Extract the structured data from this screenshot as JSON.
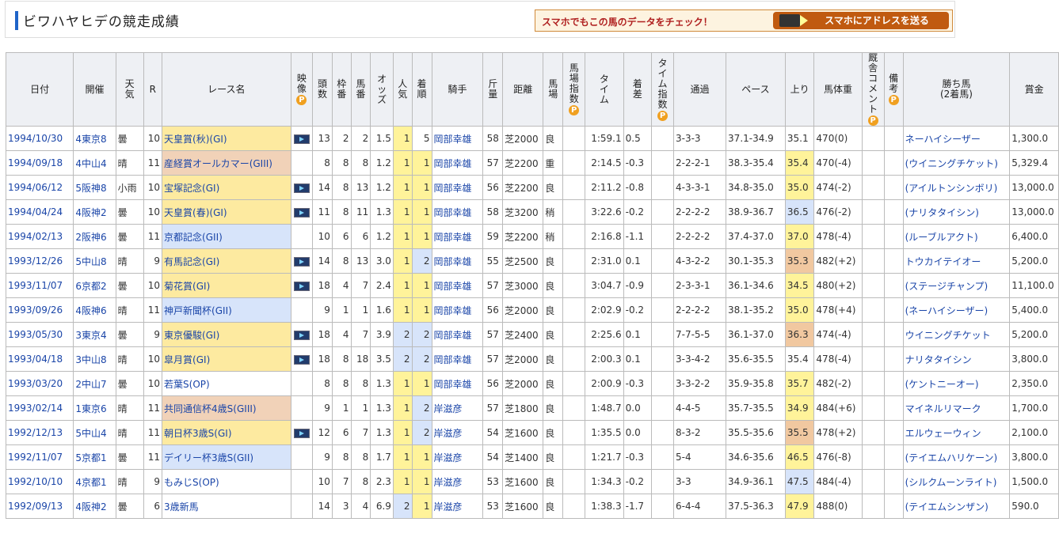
{
  "header": {
    "title": "ビワハヤヒデの競走成績",
    "smapho_text": "スマホでもこの馬のデータをチェック！",
    "smapho_button": "スマホにアドレスを送る"
  },
  "columns": [
    "日付",
    "開催",
    "天気",
    "R",
    "レース名",
    "映像",
    "頭数",
    "枠番",
    "馬番",
    "オッズ",
    "人気",
    "着順",
    "騎手",
    "斤量",
    "距離",
    "馬場",
    "馬場指数",
    "タイム",
    "着差",
    "タイム指数",
    "通過",
    "ペース",
    "上り",
    "馬体重",
    "厩舎コメント",
    "備考",
    "勝ち馬(2着馬)",
    "賞金"
  ],
  "colors": {
    "accent": "#1f64c8",
    "g1": "#fdeaa0",
    "g2": "#d7e4fa",
    "g3": "#f1d2b8",
    "link": "#1a45a8"
  },
  "rows": [
    {
      "date": "1994/10/30",
      "venue": "4東京8",
      "weather": "曇",
      "r": "10",
      "race": "天皇賞(秋)(GI)",
      "grade": "g1",
      "video": true,
      "n": "13",
      "waku": "2",
      "uma": "2",
      "odds": "1.5",
      "pop": "1",
      "rank": "5",
      "jockey": "岡部幸雄",
      "kin": "58",
      "dist": "芝2000",
      "baba": "良",
      "time": "1:59.1",
      "diff": "0.5",
      "pass": "3-3-3",
      "pace": "37.1-34.9",
      "up": "35.1",
      "upc": "",
      "weight": "470(0)",
      "winner": "ネーハイシーザー",
      "prize": "1,300.0"
    },
    {
      "date": "1994/09/18",
      "venue": "4中山4",
      "weather": "晴",
      "r": "11",
      "race": "産経賞オールカマー(GIII)",
      "grade": "g3",
      "video": false,
      "n": "8",
      "waku": "8",
      "uma": "8",
      "odds": "1.2",
      "pop": "1",
      "rank": "1",
      "jockey": "岡部幸雄",
      "kin": "57",
      "dist": "芝2200",
      "baba": "重",
      "time": "2:14.5",
      "diff": "-0.3",
      "pass": "2-2-2-1",
      "pace": "38.3-35.4",
      "up": "35.4",
      "upc": "up1",
      "weight": "470(-4)",
      "winner": "(ウイニングチケット)",
      "prize": "5,329.4"
    },
    {
      "date": "1994/06/12",
      "venue": "5阪神8",
      "weather": "小雨",
      "r": "10",
      "race": "宝塚記念(GI)",
      "grade": "g1",
      "video": true,
      "n": "14",
      "waku": "8",
      "uma": "13",
      "odds": "1.2",
      "pop": "1",
      "rank": "1",
      "jockey": "岡部幸雄",
      "kin": "56",
      "dist": "芝2200",
      "baba": "良",
      "time": "2:11.2",
      "diff": "-0.8",
      "pass": "4-3-3-1",
      "pace": "34.8-35.0",
      "up": "35.0",
      "upc": "up1",
      "weight": "474(-2)",
      "winner": "(アイルトンシンボリ)",
      "prize": "13,000.0"
    },
    {
      "date": "1994/04/24",
      "venue": "4阪神2",
      "weather": "曇",
      "r": "10",
      "race": "天皇賞(春)(GI)",
      "grade": "g1",
      "video": true,
      "n": "11",
      "waku": "8",
      "uma": "11",
      "odds": "1.3",
      "pop": "1",
      "rank": "1",
      "jockey": "岡部幸雄",
      "kin": "58",
      "dist": "芝3200",
      "baba": "稍",
      "time": "3:22.6",
      "diff": "-0.2",
      "pass": "2-2-2-2",
      "pace": "38.9-36.7",
      "up": "36.5",
      "upc": "up2",
      "weight": "476(-2)",
      "winner": "(ナリタタイシン)",
      "prize": "13,000.0"
    },
    {
      "date": "1994/02/13",
      "venue": "2阪神6",
      "weather": "曇",
      "r": "11",
      "race": "京都記念(GII)",
      "grade": "g2",
      "video": false,
      "n": "10",
      "waku": "6",
      "uma": "6",
      "odds": "1.2",
      "pop": "1",
      "rank": "1",
      "jockey": "岡部幸雄",
      "kin": "59",
      "dist": "芝2200",
      "baba": "稍",
      "time": "2:16.8",
      "diff": "-1.1",
      "pass": "2-2-2-2",
      "pace": "37.4-37.0",
      "up": "37.0",
      "upc": "up1",
      "weight": "478(-4)",
      "winner": "(ルーブルアクト)",
      "prize": "6,400.0"
    },
    {
      "date": "1993/12/26",
      "venue": "5中山8",
      "weather": "晴",
      "r": "9",
      "race": "有馬記念(GI)",
      "grade": "g1",
      "video": true,
      "n": "14",
      "waku": "8",
      "uma": "13",
      "odds": "3.0",
      "pop": "1",
      "rank": "2",
      "jockey": "岡部幸雄",
      "kin": "55",
      "dist": "芝2500",
      "baba": "良",
      "time": "2:31.0",
      "diff": "0.1",
      "pass": "4-3-2-2",
      "pace": "30.1-35.3",
      "up": "35.3",
      "upc": "up3",
      "weight": "482(+2)",
      "winner": "トウカイテイオー",
      "prize": "5,200.0"
    },
    {
      "date": "1993/11/07",
      "venue": "6京都2",
      "weather": "曇",
      "r": "10",
      "race": "菊花賞(GI)",
      "grade": "g1",
      "video": true,
      "n": "18",
      "waku": "4",
      "uma": "7",
      "odds": "2.4",
      "pop": "1",
      "rank": "1",
      "jockey": "岡部幸雄",
      "kin": "57",
      "dist": "芝3000",
      "baba": "良",
      "time": "3:04.7",
      "diff": "-0.9",
      "pass": "2-3-3-1",
      "pace": "36.1-34.6",
      "up": "34.5",
      "upc": "up1",
      "weight": "480(+2)",
      "winner": "(ステージチャンプ)",
      "prize": "11,100.0"
    },
    {
      "date": "1993/09/26",
      "venue": "4阪神6",
      "weather": "晴",
      "r": "11",
      "race": "神戸新聞杯(GII)",
      "grade": "g2",
      "video": false,
      "n": "9",
      "waku": "1",
      "uma": "1",
      "odds": "1.6",
      "pop": "1",
      "rank": "1",
      "jockey": "岡部幸雄",
      "kin": "56",
      "dist": "芝2000",
      "baba": "良",
      "time": "2:02.9",
      "diff": "-0.2",
      "pass": "2-2-2-2",
      "pace": "38.1-35.2",
      "up": "35.0",
      "upc": "up1",
      "weight": "478(+4)",
      "winner": "(ネーハイシーザー)",
      "prize": "5,400.0"
    },
    {
      "date": "1993/05/30",
      "venue": "3東京4",
      "weather": "曇",
      "r": "9",
      "race": "東京優駿(GI)",
      "grade": "g1",
      "video": true,
      "n": "18",
      "waku": "4",
      "uma": "7",
      "odds": "3.9",
      "pop": "2",
      "rank": "2",
      "jockey": "岡部幸雄",
      "kin": "57",
      "dist": "芝2400",
      "baba": "良",
      "time": "2:25.6",
      "diff": "0.1",
      "pass": "7-7-5-5",
      "pace": "36.1-37.0",
      "up": "36.3",
      "upc": "up3",
      "weight": "474(-4)",
      "winner": "ウイニングチケット",
      "prize": "5,200.0"
    },
    {
      "date": "1993/04/18",
      "venue": "3中山8",
      "weather": "晴",
      "r": "10",
      "race": "皐月賞(GI)",
      "grade": "g1",
      "video": true,
      "n": "18",
      "waku": "8",
      "uma": "18",
      "odds": "3.5",
      "pop": "2",
      "rank": "2",
      "jockey": "岡部幸雄",
      "kin": "57",
      "dist": "芝2000",
      "baba": "良",
      "time": "2:00.3",
      "diff": "0.1",
      "pass": "3-3-4-2",
      "pace": "35.6-35.5",
      "up": "35.4",
      "upc": "",
      "weight": "478(-4)",
      "winner": "ナリタタイシン",
      "prize": "3,800.0"
    },
    {
      "date": "1993/03/20",
      "venue": "2中山7",
      "weather": "曇",
      "r": "10",
      "race": "若葉S(OP)",
      "grade": "",
      "video": false,
      "n": "8",
      "waku": "8",
      "uma": "8",
      "odds": "1.3",
      "pop": "1",
      "rank": "1",
      "jockey": "岡部幸雄",
      "kin": "56",
      "dist": "芝2000",
      "baba": "良",
      "time": "2:00.9",
      "diff": "-0.3",
      "pass": "3-3-2-2",
      "pace": "35.9-35.8",
      "up": "35.7",
      "upc": "up1",
      "weight": "482(-2)",
      "winner": "(ケントニーオー)",
      "prize": "2,350.0"
    },
    {
      "date": "1993/02/14",
      "venue": "1東京6",
      "weather": "晴",
      "r": "11",
      "race": "共同通信杯4歳S(GIII)",
      "grade": "g3",
      "video": false,
      "n": "9",
      "waku": "1",
      "uma": "1",
      "odds": "1.3",
      "pop": "1",
      "rank": "2",
      "jockey": "岸滋彦",
      "kin": "57",
      "dist": "芝1800",
      "baba": "良",
      "time": "1:48.7",
      "diff": "0.0",
      "pass": "4-4-5",
      "pace": "35.7-35.5",
      "up": "34.9",
      "upc": "up1",
      "weight": "484(+6)",
      "winner": "マイネルリマーク",
      "prize": "1,700.0"
    },
    {
      "date": "1992/12/13",
      "venue": "5中山4",
      "weather": "晴",
      "r": "11",
      "race": "朝日杯3歳S(GI)",
      "grade": "g1",
      "video": true,
      "n": "12",
      "waku": "6",
      "uma": "7",
      "odds": "1.3",
      "pop": "1",
      "rank": "2",
      "jockey": "岸滋彦",
      "kin": "54",
      "dist": "芝1600",
      "baba": "良",
      "time": "1:35.5",
      "diff": "0.0",
      "pass": "8-3-2",
      "pace": "35.5-35.6",
      "up": "35.5",
      "upc": "up3",
      "weight": "478(+2)",
      "winner": "エルウェーウィン",
      "prize": "2,100.0"
    },
    {
      "date": "1992/11/07",
      "venue": "5京都1",
      "weather": "曇",
      "r": "11",
      "race": "デイリー杯3歳S(GII)",
      "grade": "g2",
      "video": false,
      "n": "9",
      "waku": "8",
      "uma": "8",
      "odds": "1.7",
      "pop": "1",
      "rank": "1",
      "jockey": "岸滋彦",
      "kin": "54",
      "dist": "芝1400",
      "baba": "良",
      "time": "1:21.7",
      "diff": "-0.3",
      "pass": "5-4",
      "pace": "34.6-35.6",
      "up": "46.5",
      "upc": "up1",
      "weight": "476(-8)",
      "winner": "(テイエムハリケーン)",
      "prize": "3,800.0"
    },
    {
      "date": "1992/10/10",
      "venue": "4京都1",
      "weather": "晴",
      "r": "9",
      "race": "もみじS(OP)",
      "grade": "",
      "video": false,
      "n": "10",
      "waku": "7",
      "uma": "8",
      "odds": "2.3",
      "pop": "1",
      "rank": "1",
      "jockey": "岸滋彦",
      "kin": "53",
      "dist": "芝1600",
      "baba": "良",
      "time": "1:34.3",
      "diff": "-0.2",
      "pass": "3-3",
      "pace": "34.9-36.1",
      "up": "47.5",
      "upc": "up2",
      "weight": "484(-4)",
      "winner": "(シルクムーンライト)",
      "prize": "1,500.0"
    },
    {
      "date": "1992/09/13",
      "venue": "4阪神2",
      "weather": "曇",
      "r": "6",
      "race": "3歳新馬",
      "grade": "",
      "video": false,
      "n": "14",
      "waku": "3",
      "uma": "4",
      "odds": "6.9",
      "pop": "2",
      "rank": "1",
      "jockey": "岸滋彦",
      "kin": "53",
      "dist": "芝1600",
      "baba": "良",
      "time": "1:38.3",
      "diff": "-1.7",
      "pass": "6-4-4",
      "pace": "37.5-36.3",
      "up": "47.9",
      "upc": "up1",
      "weight": "488(0)",
      "winner": "(テイエムシンザン)",
      "prize": "590.0"
    }
  ]
}
